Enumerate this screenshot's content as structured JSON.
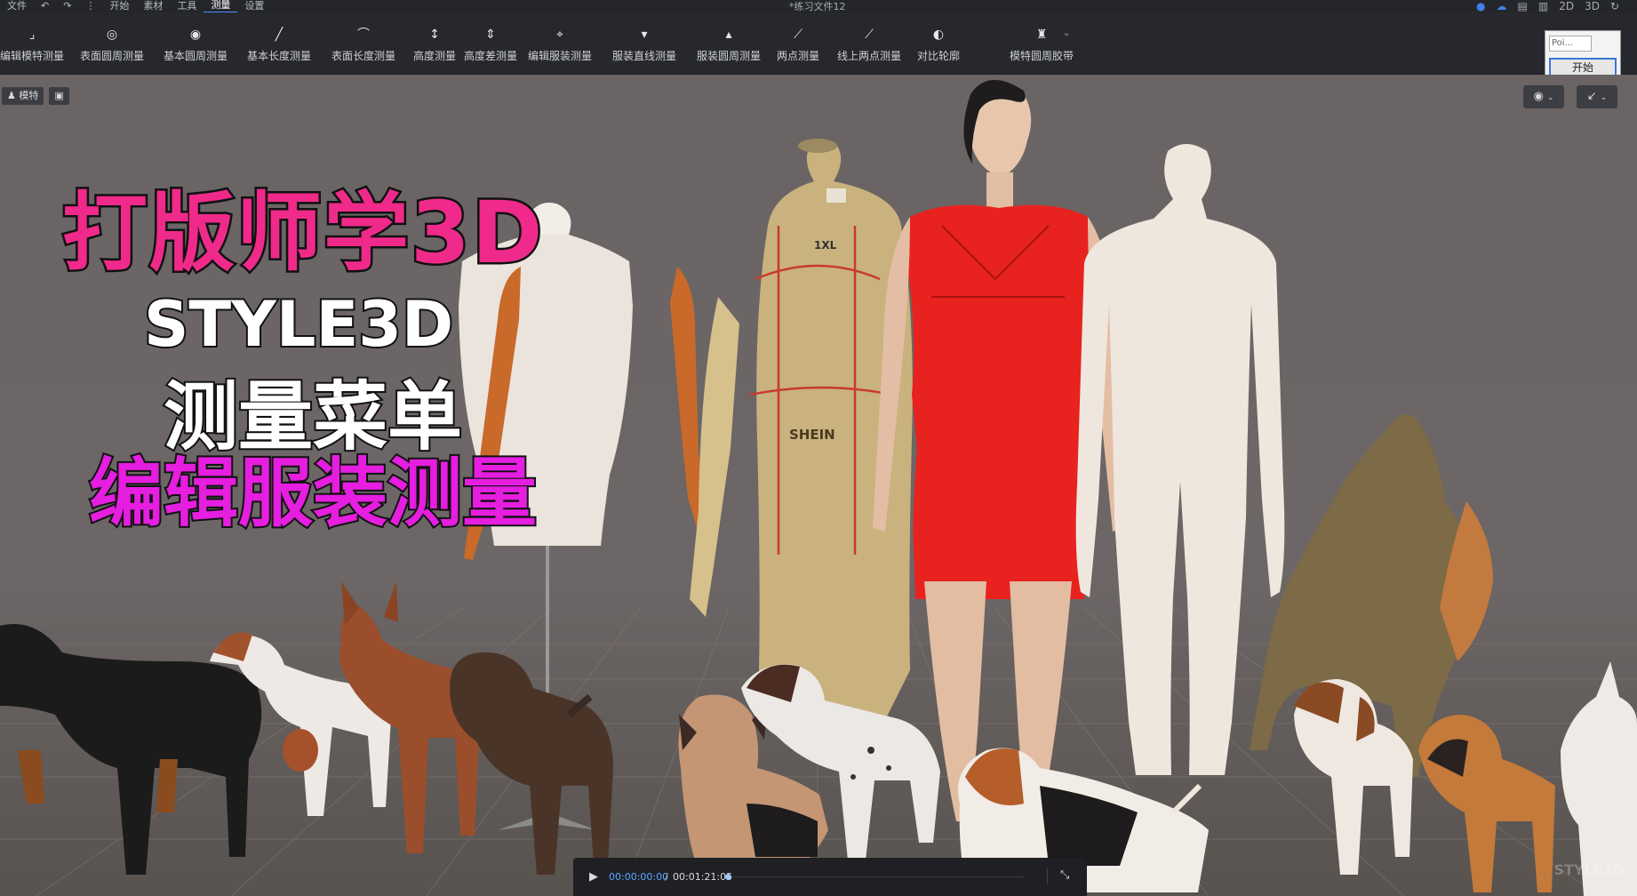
{
  "menu": {
    "items": [
      "文件",
      "开始",
      "素材",
      "工具",
      "测量",
      "设置"
    ],
    "active": "测量",
    "doc_title": "*练习文件12",
    "right_items": [
      "2D",
      "3D"
    ]
  },
  "toolbar": {
    "tools": [
      {
        "label": "编辑模特测量",
        "icon": "edit-avatar-measure-icon"
      },
      {
        "label": "表面圆周测量",
        "icon": "surface-circumference-icon"
      },
      {
        "label": "基本圆周测量",
        "icon": "basic-circumference-icon"
      },
      {
        "label": "基本长度测量",
        "icon": "basic-length-icon"
      },
      {
        "label": "表面长度测量",
        "icon": "surface-length-icon"
      },
      {
        "label": "高度测量",
        "icon": "height-measure-icon"
      },
      {
        "label": "高度差测量",
        "icon": "height-diff-icon"
      },
      {
        "label": "编辑服装测量",
        "icon": "edit-garment-measure-icon"
      },
      {
        "label": "服装直线测量",
        "icon": "garment-straight-icon"
      },
      {
        "label": "服装圆周测量",
        "icon": "garment-circumference-icon"
      },
      {
        "label": "两点测量",
        "icon": "two-point-icon"
      },
      {
        "label": "线上两点测量",
        "icon": "line-two-point-icon"
      },
      {
        "label": "对比轮廓",
        "icon": "compare-outline-icon"
      },
      {
        "label": "模特圆周胶带",
        "icon": "avatar-tape-icon"
      }
    ],
    "point_input": "Poi...",
    "start_button": "开始"
  },
  "viewport": {
    "tab_label": "模特"
  },
  "overlay": {
    "title_main": "打版师学3D",
    "title_style3d": "STYLE3D",
    "title_menu": "测量菜单",
    "title_edit": "编辑服装测量"
  },
  "mannequin": {
    "tag": "1XL",
    "brand": "SHEIN"
  },
  "player": {
    "current_time": "00:00:00:00",
    "separator": "/",
    "total_time": "00:01:21:05",
    "progress": 0
  },
  "watermark": "STYLE3D",
  "colors": {
    "pink_title": "#f02a8a",
    "magenta_title": "#e51ee0",
    "dress_red": "#e8221e",
    "accent_blue": "#4d8dff"
  }
}
